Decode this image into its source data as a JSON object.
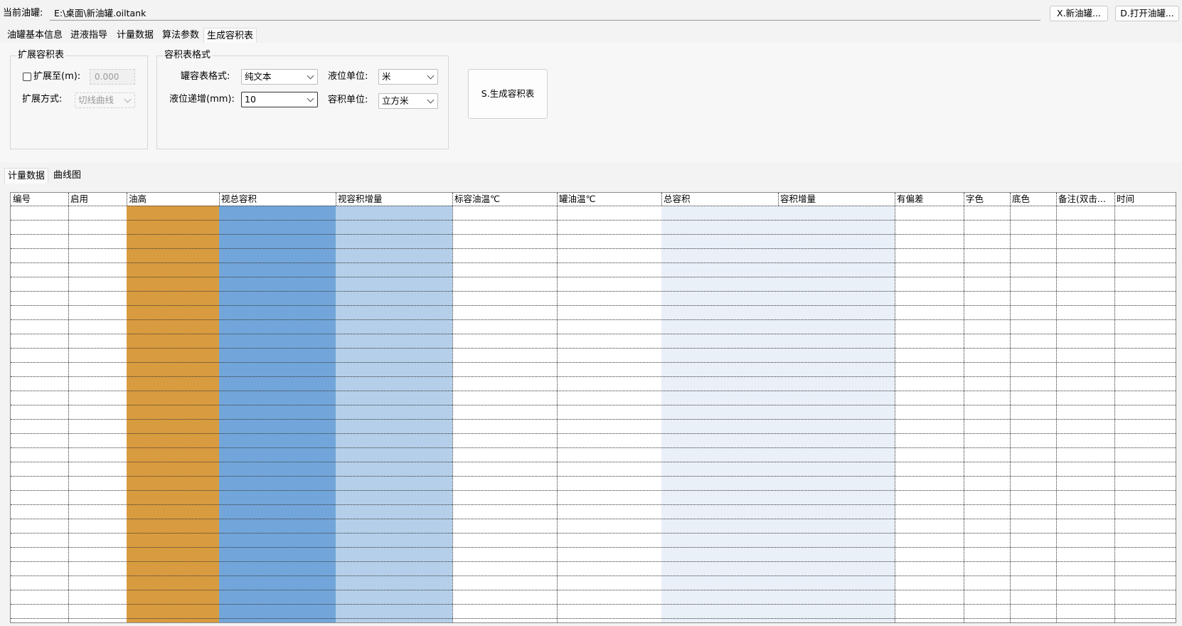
{
  "header": {
    "current_tank_label": "当前油罐:",
    "current_tank_path": "E:\\桌面\\新油罐.oiltank",
    "new_tank_button": "X.新油罐...",
    "open_tank_button": "D.打开油罐..."
  },
  "main_tabs": [
    {
      "label": "油罐基本信息",
      "active": false
    },
    {
      "label": "进液指导",
      "active": false
    },
    {
      "label": "计量数据",
      "active": false
    },
    {
      "label": "算法参数",
      "active": false
    },
    {
      "label": "生成容积表",
      "active": true
    }
  ],
  "expand_group": {
    "title": "扩展容积表",
    "expand_to_label": "扩展至(m):",
    "expand_to_checked": false,
    "expand_to_value": "0.000",
    "method_label": "扩展方式:",
    "method_value": "切线曲线"
  },
  "format_group": {
    "title": "容积表格式",
    "format_label": "罐容表格式:",
    "format_value": "纯文本",
    "level_unit_label": "液位单位:",
    "level_unit_value": "米",
    "increment_label": "液位递增(mm):",
    "increment_value": "10",
    "volume_unit_label": "容积单位:",
    "volume_unit_value": "立方米"
  },
  "generate_button": "S.生成容积表",
  "sub_tabs": [
    {
      "label": "计量数据",
      "active": true
    },
    {
      "label": "曲线图",
      "active": false
    }
  ],
  "grid": {
    "columns": [
      {
        "label": "编号",
        "color": "#ffffff"
      },
      {
        "label": "启用",
        "color": "#ffffff"
      },
      {
        "label": "油高",
        "color": "#d99b3f"
      },
      {
        "label": "视总容积",
        "color": "#72a6da"
      },
      {
        "label": "视容积增量",
        "color": "#b5cfea"
      },
      {
        "label": "标容油温℃",
        "color": "#ffffff"
      },
      {
        "label": "罐油温℃",
        "color": "#ffffff"
      },
      {
        "label": "总容积",
        "color": "#e9f0f8"
      },
      {
        "label": "容积增量",
        "color": "#e9f0f8"
      },
      {
        "label": "有偏差",
        "color": "#ffffff"
      },
      {
        "label": "字色",
        "color": "#ffffff"
      },
      {
        "label": "底色",
        "color": "#ffffff"
      },
      {
        "label": "备注(双击...",
        "color": "#ffffff"
      },
      {
        "label": "时间",
        "color": "#ffffff"
      }
    ]
  }
}
